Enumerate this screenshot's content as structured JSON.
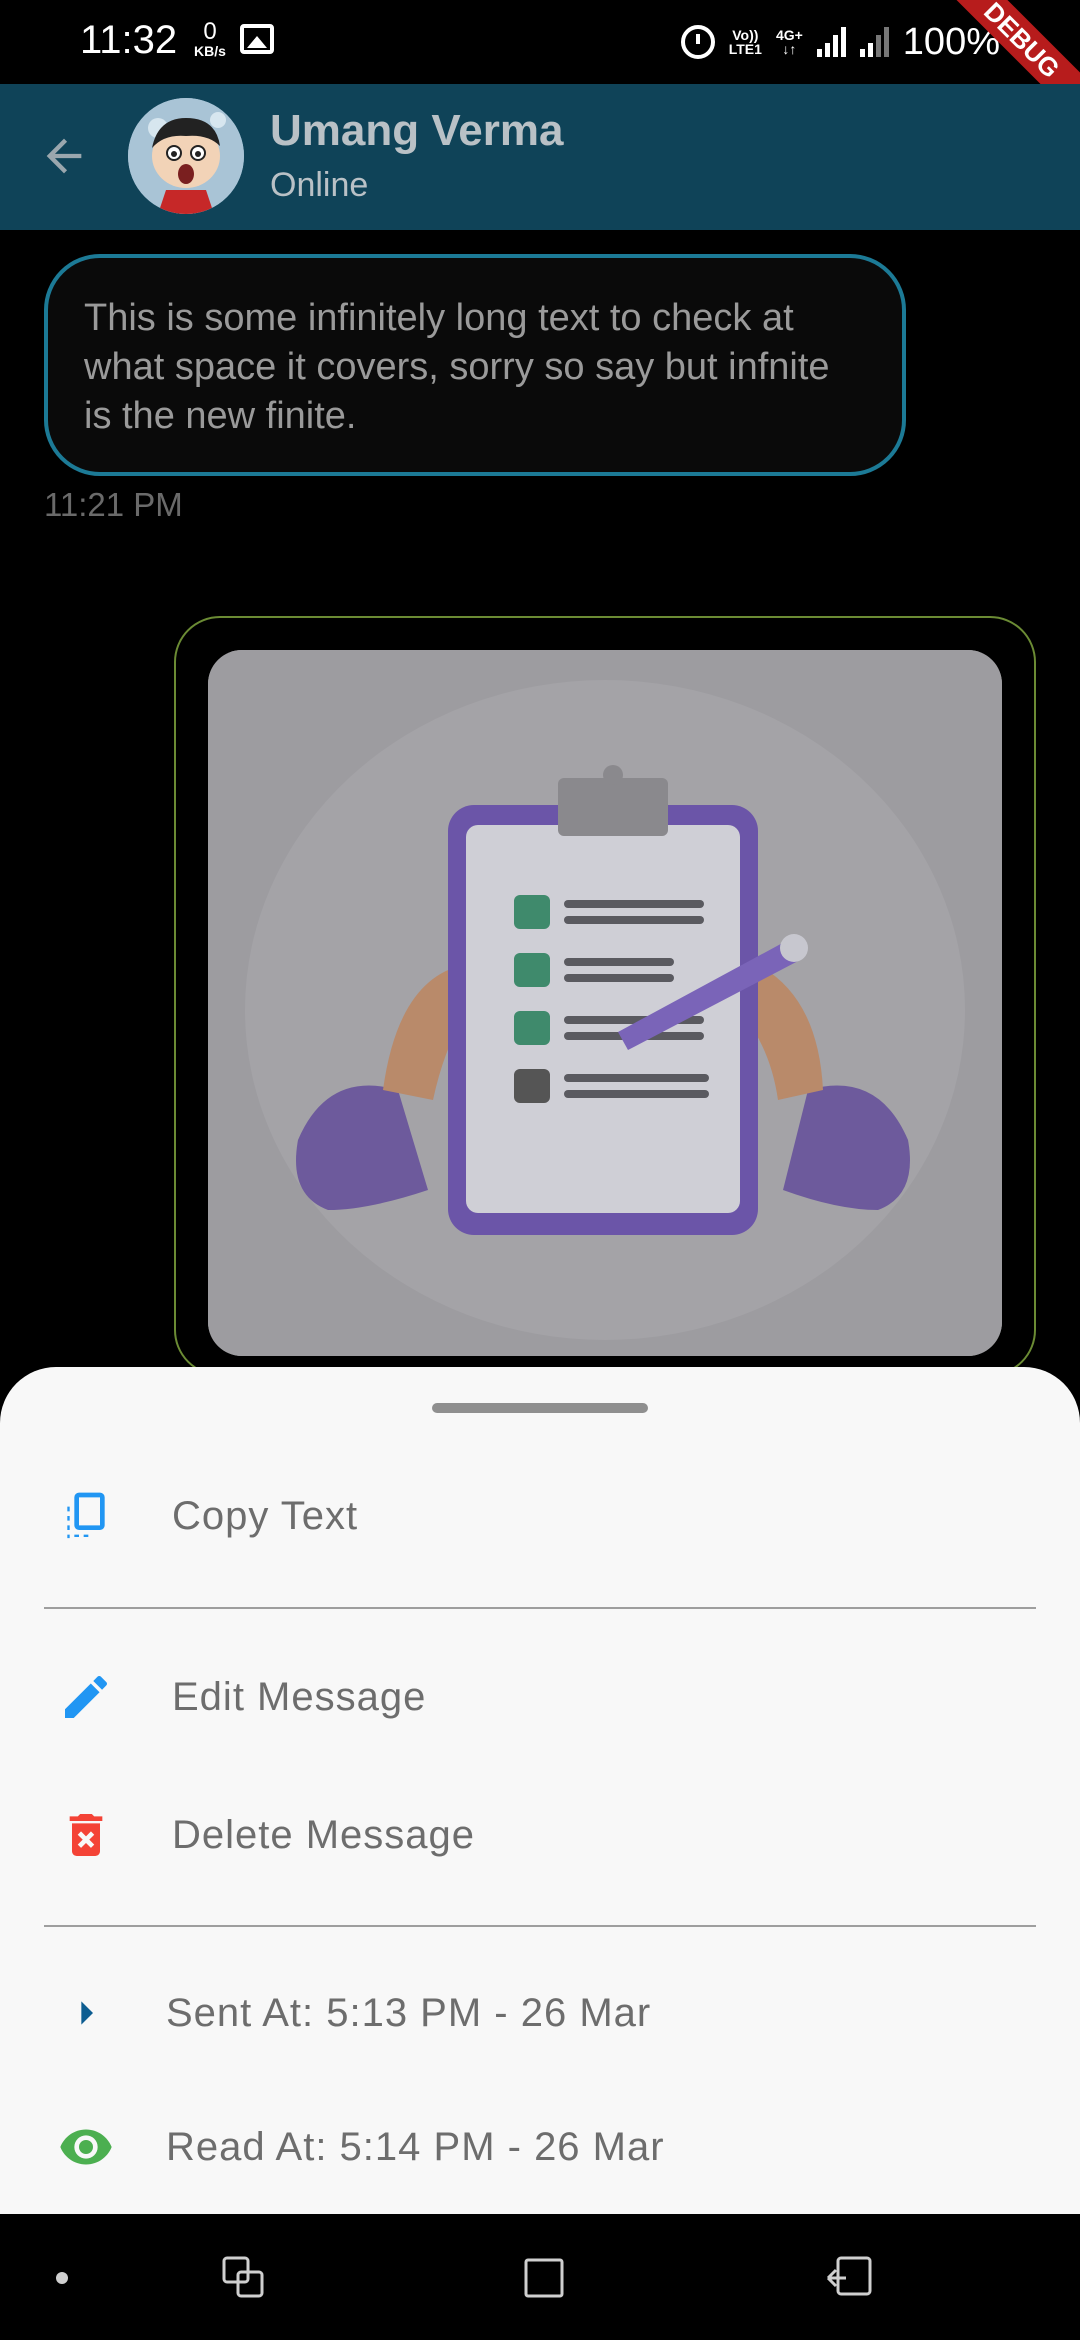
{
  "status_bar": {
    "time": "11:32",
    "data_rate": "0",
    "data_rate_unit": "KB/s",
    "volte_line1": "Vo))",
    "volte_line2": "LTE1",
    "network": "4G+",
    "battery": "100%",
    "debug_banner": "DEBUG"
  },
  "app_bar": {
    "contact_name": "Umang Verma",
    "contact_status": "Online"
  },
  "chat": {
    "messages": [
      {
        "text": "This is some infinitely long text to check at what space it covers, sorry so say but infnite is the new finite.",
        "time": "11:21 PM"
      }
    ]
  },
  "sheet": {
    "items": [
      {
        "label": "Copy Text",
        "icon": "copy-icon"
      },
      {
        "label": "Edit Message",
        "icon": "edit-icon"
      },
      {
        "label": "Delete Message",
        "icon": "delete-icon"
      },
      {
        "label": "Sent At: 5:13 PM - 26 Mar",
        "icon": "sent-arrow-icon"
      },
      {
        "label": "Read At: 5:14 PM - 26 Mar",
        "icon": "eye-icon"
      }
    ]
  },
  "colors": {
    "app_bar": "#0f4358",
    "incoming_border": "#1c7a96",
    "image_border": "#6b8b34",
    "accent_blue": "#2196f3",
    "delete_red": "#f44336",
    "read_green": "#4caf50",
    "sent_blue": "#0d5d91"
  }
}
